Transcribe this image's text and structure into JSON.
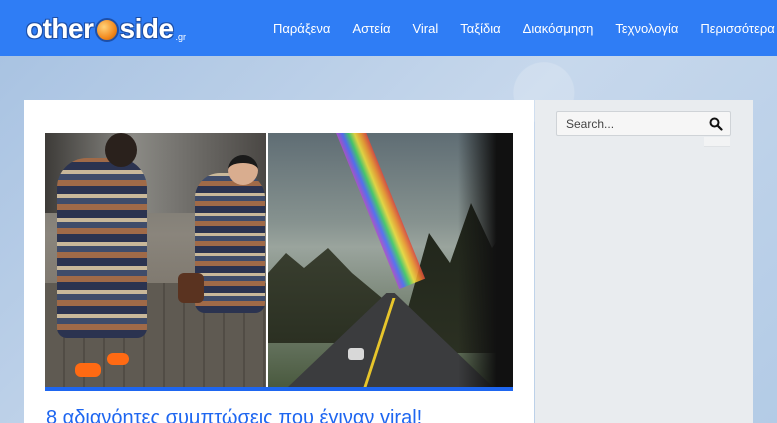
{
  "header": {
    "logo": {
      "text_left": "other",
      "text_right": "side",
      "suffix": ".gr"
    },
    "nav": [
      {
        "label": "Παράξενα"
      },
      {
        "label": "Αστεία"
      },
      {
        "label": "Viral"
      },
      {
        "label": "Ταξίδια"
      },
      {
        "label": "Διακόσμηση"
      },
      {
        "label": "Τεχνολογία"
      },
      {
        "label": "Περισσότερα"
      }
    ]
  },
  "main": {
    "post": {
      "title": "8 αδιανόητες συμπτώσεις που έγιναν viral!"
    }
  },
  "sidebar": {
    "search": {
      "placeholder": "Search..."
    }
  },
  "colors": {
    "header_bg": "#2f7df5",
    "accent": "#1e66f0",
    "sidebar_bg": "#e9ecef"
  },
  "icons": {
    "search": "search-icon",
    "logo_ball": "ball-icon"
  }
}
